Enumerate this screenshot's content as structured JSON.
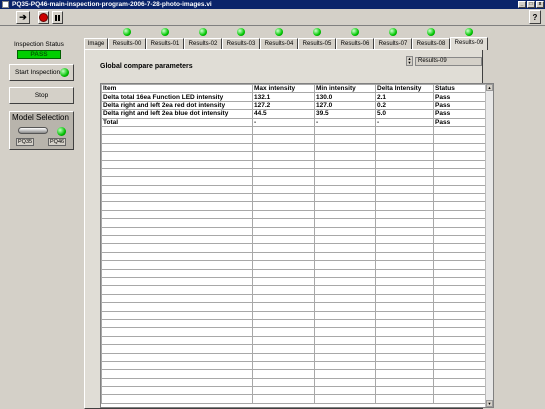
{
  "window": {
    "title": "PQ35-PQ46-main-inspection-program-2006-7-28-photo-images.vi"
  },
  "left_panel": {
    "inspection_status_label": "Inspection Status",
    "inspection_status_value": "PASS",
    "start_label": "Start Inspection",
    "stop_label": "Stop",
    "model_selection_title": "Model Selection",
    "model_options": [
      "PQ35",
      "PQ46"
    ]
  },
  "tabs": [
    "Image",
    "Results-00",
    "Results-01",
    "Results-02",
    "Results-03",
    "Results-04",
    "Results-05",
    "Results-06",
    "Results-07",
    "Results-08",
    "Results-09"
  ],
  "active_tab": "Results-09",
  "panel": {
    "heading": "Global compare parameters",
    "selector_value": "Results-09"
  },
  "table": {
    "headers": [
      "Item",
      "Max intensity",
      "Min intensity",
      "Delta Intensity",
      "Status"
    ],
    "rows": [
      [
        "Delta total 16ea Function LED intensity",
        "132.1",
        "130.0",
        "2.1",
        "Pass"
      ],
      [
        "Delta right and left 2ea red dot intensity",
        "127.2",
        "127.0",
        "0.2",
        "Pass"
      ],
      [
        "Delta right and left 2ea blue dot intensity",
        "44.5",
        "39.5",
        "5.0",
        "Pass"
      ],
      [
        "Total",
        "-",
        "-",
        "-",
        "Pass"
      ]
    ]
  },
  "colors": {
    "title_bar": "#0a246a",
    "pass": "#00d000",
    "led": "#00c800"
  }
}
